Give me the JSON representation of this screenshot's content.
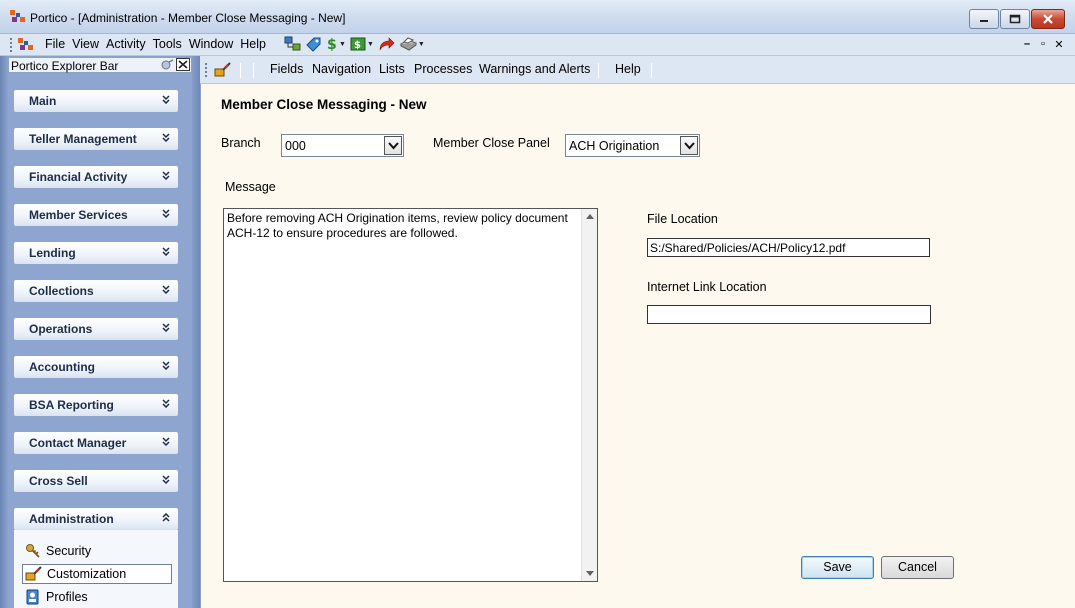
{
  "window": {
    "title": "Portico - [Administration - Member Close Messaging - New]"
  },
  "menubar": {
    "items": [
      "File",
      "View",
      "Activity",
      "Tools",
      "Window",
      "Help"
    ],
    "tool_icons": [
      "network-icon",
      "tag-icon",
      "dollar-icon",
      "cash-icon",
      "redo-arrow-icon",
      "printer-icon"
    ]
  },
  "explorer": {
    "title": "Portico Explorer Bar",
    "groups": [
      "Main",
      "Teller Management",
      "Financial Activity",
      "Member Services",
      "Lending",
      "Collections",
      "Operations",
      "Accounting",
      "BSA Reporting",
      "Contact Manager",
      "Cross Sell",
      "Administration"
    ],
    "admin_items": [
      {
        "label": "Security",
        "icon": "keys-icon"
      },
      {
        "label": "Customization",
        "icon": "paint-brush-icon",
        "selected": true
      },
      {
        "label": "Profiles",
        "icon": "profiles-icon"
      }
    ]
  },
  "ws_toolbar": {
    "items": [
      "Fields",
      "Navigation",
      "Lists",
      "Processes",
      "Warnings and Alerts",
      "Help"
    ]
  },
  "form": {
    "title": "Member Close Messaging - New",
    "branch_label": "Branch",
    "branch_value": "000",
    "panel_label": "Member Close Panel",
    "panel_value": "ACH Origination",
    "message_label": "Message",
    "message_value": "Before removing ACH Origination items, review policy document ACH-12 to ensure procedures are followed.",
    "file_location_label": "File Location",
    "file_location_value": "S:/Shared/Policies/ACH/Policy12.pdf",
    "internet_link_label": "Internet Link Location",
    "internet_link_value": "",
    "save_label": "Save",
    "cancel_label": "Cancel"
  },
  "colors": {
    "explorer_bg": "#8aa2cc",
    "content_bg": "#fdf9ee",
    "toolbar_bg": "#dde7f3",
    "close_button": "#c94a33"
  }
}
